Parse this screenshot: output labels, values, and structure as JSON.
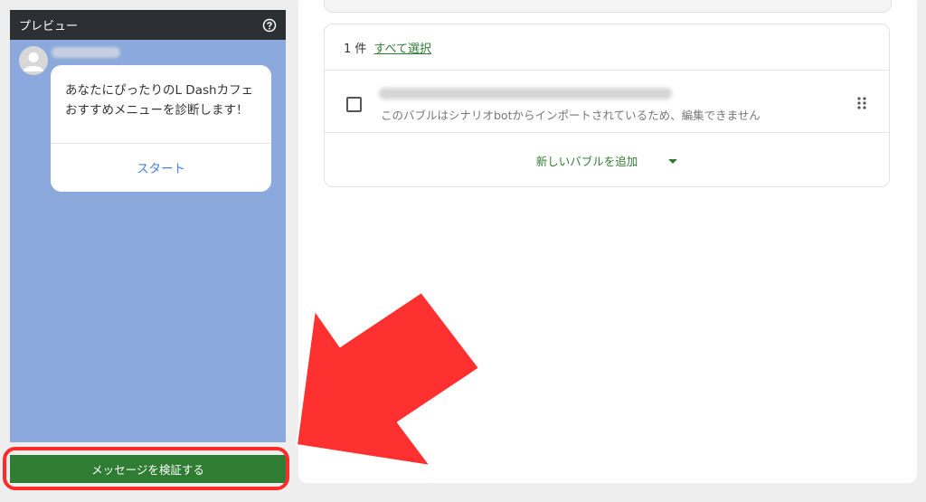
{
  "preview": {
    "title": "プレビュー",
    "message": "あなたにぴったりのL Dashカフェおすすめメニューを診断します！",
    "action_label": "スタート",
    "verify_button": "メッセージを検証する"
  },
  "bubble_list": {
    "count_label": "1 件",
    "select_all": "すべて選択",
    "row_subtext": "このバブルはシナリオbotからインポートされているため、編集できません",
    "add_label": "新しいバブルを追加"
  },
  "colors": {
    "primary_green": "#2e7d32",
    "preview_bg": "#8ba9dc",
    "header_bg": "#2c2f33",
    "annotation_red": "#ff2b2b",
    "link_blue": "#4a7fd9"
  },
  "icons": [
    "help-icon",
    "avatar-icon",
    "checkbox-icon",
    "drag-handle-icon",
    "caret-down-icon",
    "annotation-arrow"
  ]
}
